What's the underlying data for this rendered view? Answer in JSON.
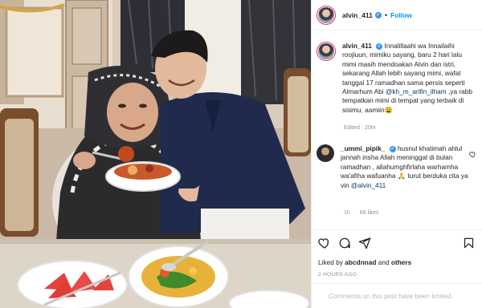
{
  "header": {
    "username": "alvin_411",
    "follow_label": "Follow",
    "separator": "•",
    "verified_mark": "✓"
  },
  "caption": {
    "username": "alvin_411",
    "text_before": "Innalillaahi wa Innailaihi roojiuun, mimiku sayang, baru 2 hari lalu mimi masih mendoakan Alvin dan istri, sekarang Allah lebih sayang mimi, wafat tanggal 17 ramadhan sama persis seperti Almarhum Abi ",
    "mention": "@kh_m_arifin_ilham",
    "text_after": " ,ya rabb tempatkan mimi di tempat yang terbaik di sisimu, aamiin",
    "emoji": "😩",
    "meta": "Edited · 20m"
  },
  "comment": {
    "username": "_ummi_pipik_",
    "text_before": "husnul khatimah ahlul jannah insha Allah meninggal di bulan ramadhan , allahumghfirlaha warhamha wa'afiha wafuanha ",
    "emoji": "🙏",
    "text_middle": " turut berduka cita ya vin ",
    "mention": "@alvin_411",
    "time": "1h",
    "likes": "66 likes"
  },
  "likes_line": {
    "prefix": "Liked by ",
    "user": "abcdnnad",
    "and": " and ",
    "others": "others"
  },
  "timestamp": "2 HOURS AGO",
  "limited_notice": "Comments on this post have been limited.",
  "icons": {
    "like": "heart-icon",
    "comment": "comment-icon",
    "share": "share-icon",
    "save": "bookmark-icon"
  },
  "colors": {
    "link": "#0095f6",
    "verified": "#3897f0",
    "muted": "#8e8e8e",
    "border": "#efefef"
  }
}
